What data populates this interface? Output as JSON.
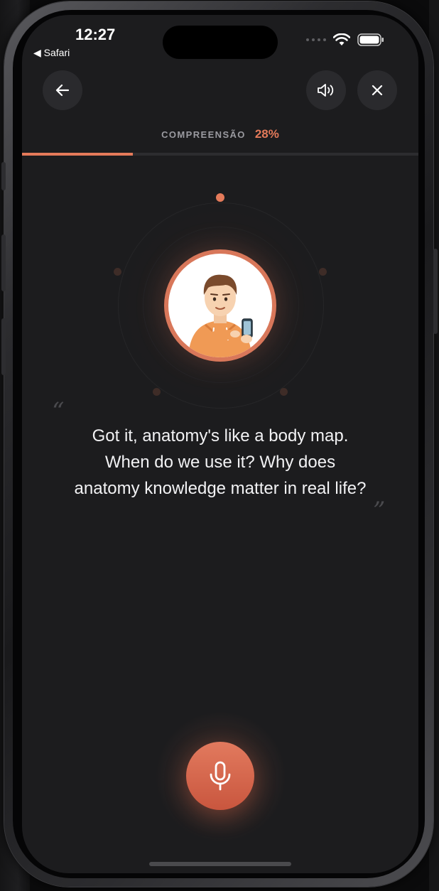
{
  "status_bar": {
    "time": "12:27",
    "back_app": "◀ Safari"
  },
  "header": {
    "back_icon": "arrow-left-icon",
    "speaker_icon": "speaker-icon",
    "close_icon": "close-icon"
  },
  "progress": {
    "label": "COMPREENSÃO",
    "percent_text": "28%",
    "value": 0.28
  },
  "quote": {
    "open_mark": "“",
    "close_mark": "”",
    "lines": [
      "Got it, anatomy's like a body map.",
      "When do we use it? Why does",
      "anatomy knowledge matter in real life?"
    ]
  },
  "mic": {
    "icon": "microphone-icon"
  },
  "colors": {
    "accent": "#e47a5a",
    "background": "#1c1c1e",
    "text": "#f2f2f4",
    "muted": "#9a9aa0"
  }
}
